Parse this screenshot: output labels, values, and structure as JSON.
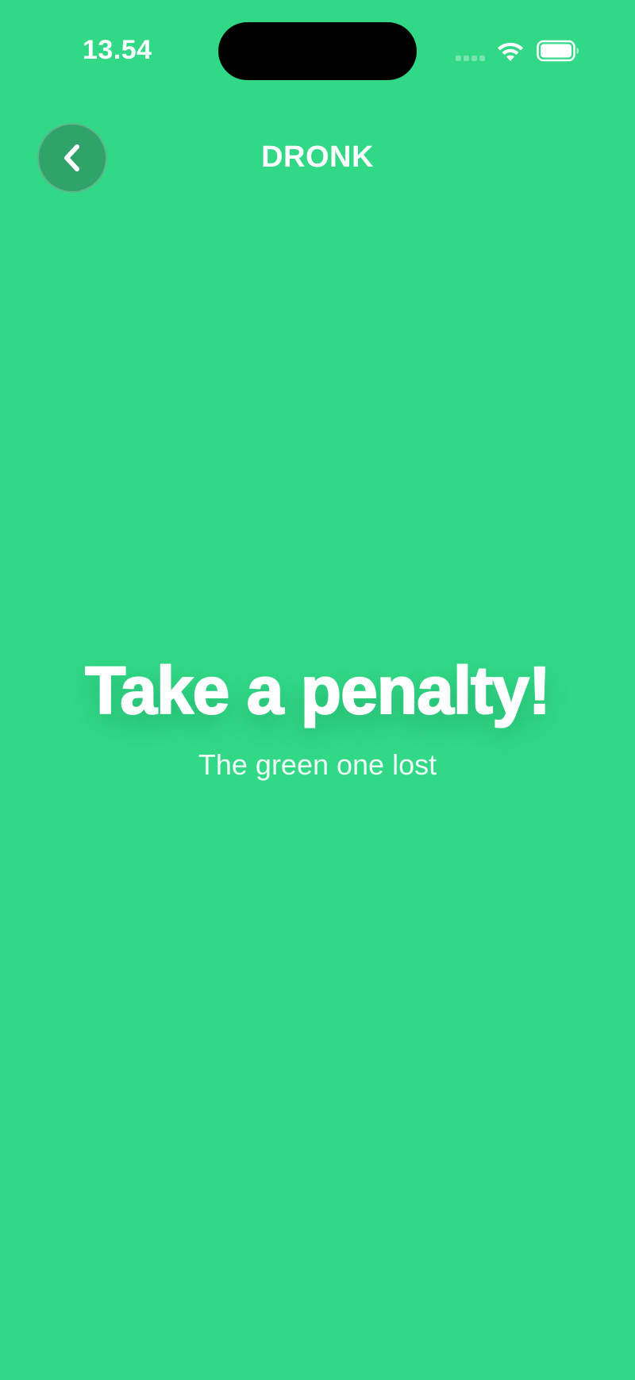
{
  "status_bar": {
    "time": "13.54"
  },
  "header": {
    "title": "DRONK",
    "back_icon": "chevron-left-icon"
  },
  "main": {
    "headline": "Take a penalty!",
    "subtitle": "The green one lost"
  },
  "colors": {
    "background": "#31d886",
    "text": "#ffffff",
    "back_button_bg": "#3a8a62"
  }
}
